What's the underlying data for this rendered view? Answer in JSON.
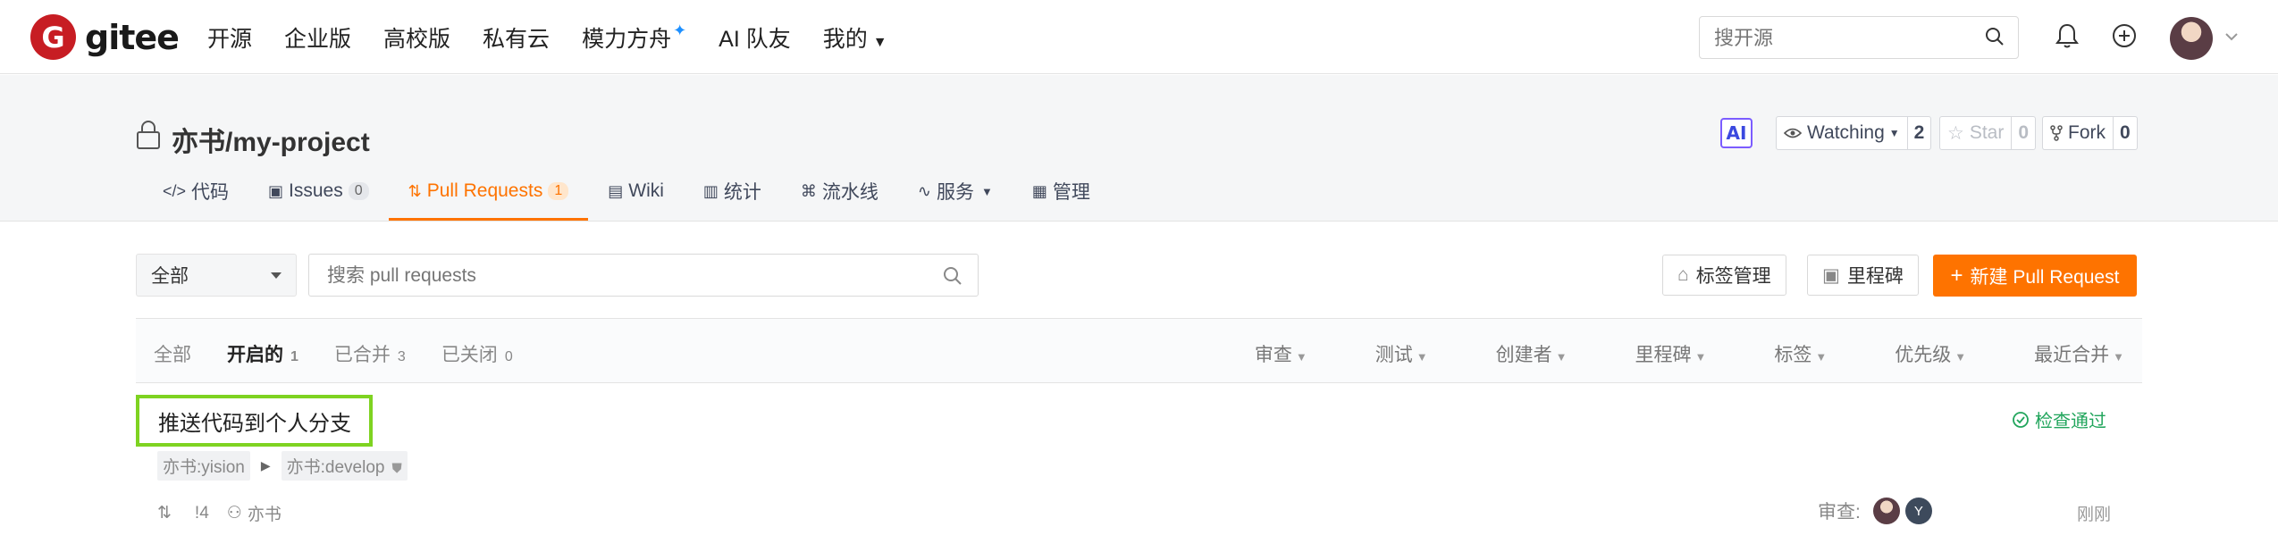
{
  "header": {
    "logo_mark": "G",
    "logo_text": "gitee",
    "nav": [
      {
        "label": "开源"
      },
      {
        "label": "企业版"
      },
      {
        "label": "高校版"
      },
      {
        "label": "私有云"
      },
      {
        "label": "模力方舟"
      },
      {
        "label": "AI 队友"
      },
      {
        "label": "我的"
      }
    ],
    "search_placeholder": "搜开源"
  },
  "project": {
    "title": "亦书/my-project",
    "ai_badge": "AI",
    "watching": {
      "label": "Watching",
      "count": "2"
    },
    "star": {
      "label": "Star",
      "count": "0"
    },
    "fork": {
      "label": "Fork",
      "count": "0"
    },
    "tabs": [
      {
        "label": "代码",
        "icon": "code-icon"
      },
      {
        "label": "Issues",
        "badge": "0",
        "icon": "issues-icon"
      },
      {
        "label": "Pull Requests",
        "badge": "1",
        "icon": "pull-request-icon",
        "active": true
      },
      {
        "label": "Wiki",
        "icon": "wiki-icon"
      },
      {
        "label": "统计",
        "icon": "chart-icon"
      },
      {
        "label": "流水线",
        "icon": "pipeline-icon"
      },
      {
        "label": "服务",
        "icon": "pulse-icon"
      },
      {
        "label": "管理",
        "icon": "settings-icon"
      }
    ]
  },
  "filterbar": {
    "select_value": "全部",
    "search_placeholder": "搜索 pull requests",
    "label_btn": "标签管理",
    "milestone_btn": "里程碑",
    "new_pr_btn": "新建 Pull Request"
  },
  "list": {
    "states": [
      {
        "label": "全部",
        "count": ""
      },
      {
        "label": "开启的",
        "count": "1",
        "active": true
      },
      {
        "label": "已合并",
        "count": "3"
      },
      {
        "label": "已关闭",
        "count": "0"
      }
    ],
    "filters": [
      "审查",
      "测试",
      "创建者",
      "里程碑",
      "标签",
      "优先级",
      "最近合并"
    ],
    "items": [
      {
        "title": "推送代码到个人分支",
        "status": "检查通过",
        "source_branch": "亦书:yision",
        "target_branch": "亦书:develop",
        "number": "!4",
        "author": "亦书",
        "review_label": "审查:",
        "reviewer_initial": "Y",
        "time": "刚刚"
      }
    ]
  },
  "colors": {
    "brand": "#c71d23",
    "accent": "#fe7300",
    "success": "#21a55c",
    "highlight": "#7ed321"
  }
}
